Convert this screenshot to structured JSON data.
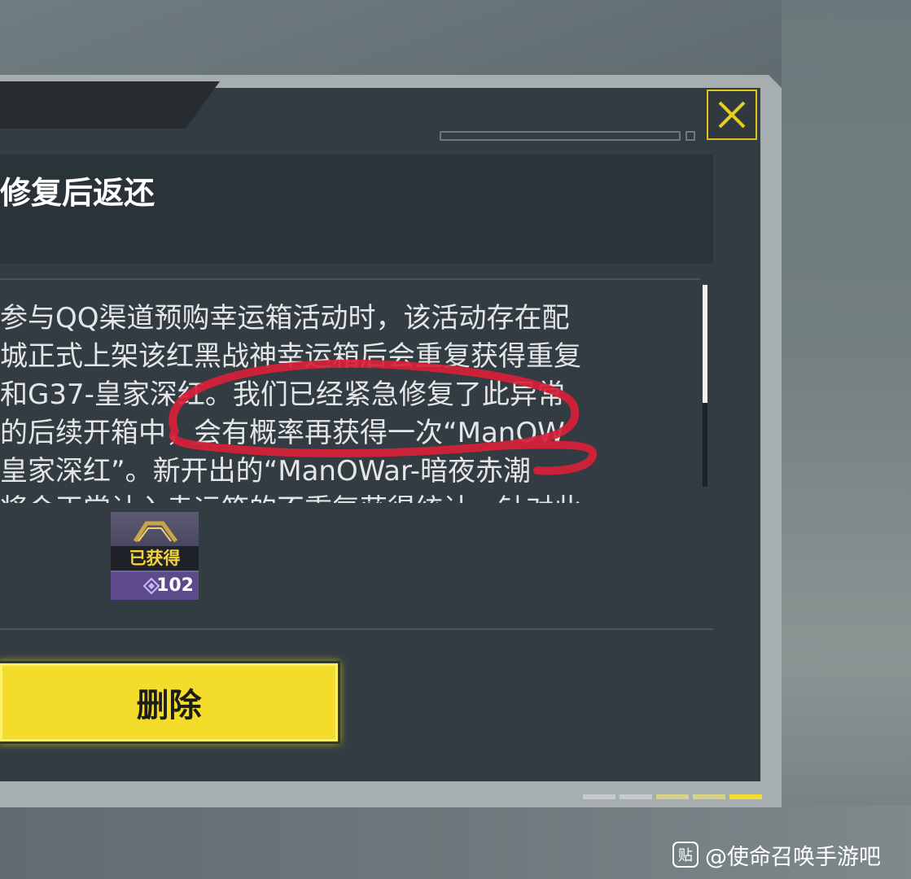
{
  "dialog": {
    "title": "修复后返还",
    "body_lines": [
      "参与QQ渠道预购幸运箱活动时，该活动存在配",
      "城正式上架该红黑战神幸运箱后会重复获得重复",
      "和G37-皇家深红。我们已经紧急修复了此异常",
      "的后续开箱中，会有概率再获得一次“ManOW",
      "皇家深红”。新开出的“ManOWar-暗夜赤潮",
      "将会正常计入幸运箱的不重复获得统计，针对此"
    ],
    "reward": {
      "badge": "已获得",
      "count": "102",
      "icon": "gem-icon"
    },
    "delete_label": "删除",
    "close_icon": "close-x-icon"
  },
  "watermark": {
    "logo": "贴",
    "text": "@使命召唤手游吧"
  },
  "colors": {
    "accent_yellow": "#f3dd2a",
    "panel": "#323c42",
    "annotation_red": "#d8213a"
  }
}
